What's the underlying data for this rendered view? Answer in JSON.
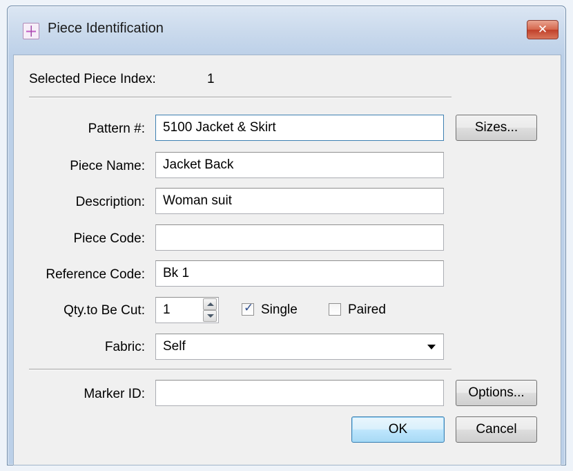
{
  "window": {
    "title": "Piece Identification",
    "close_symbol": "✕"
  },
  "selected_piece": {
    "label": "Selected Piece Index:",
    "value": "1"
  },
  "form": {
    "pattern": {
      "label": "Pattern #:",
      "value": "5100 Jacket & Skirt"
    },
    "piece_name": {
      "label": "Piece Name:",
      "value": "Jacket Back"
    },
    "description": {
      "label": "Description:",
      "value": "Woman suit"
    },
    "piece_code": {
      "label": "Piece Code:",
      "value": ""
    },
    "reference_code": {
      "label": "Reference Code:",
      "value": "Bk 1"
    },
    "qty": {
      "label": "Qty.to Be Cut:",
      "value": "1"
    },
    "single": {
      "label": "Single",
      "checked": true
    },
    "paired": {
      "label": "Paired",
      "checked": false
    },
    "fabric": {
      "label": "Fabric:",
      "value": "Self"
    },
    "marker_id": {
      "label": "Marker ID:",
      "value": ""
    }
  },
  "buttons": {
    "sizes": "Sizes...",
    "options": "Options...",
    "ok": "OK",
    "cancel": "Cancel"
  },
  "icons": [
    "app-icon",
    "close-icon",
    "spin-up-icon",
    "spin-down-icon",
    "dropdown-arrow-icon",
    "checkbox-icon"
  ]
}
